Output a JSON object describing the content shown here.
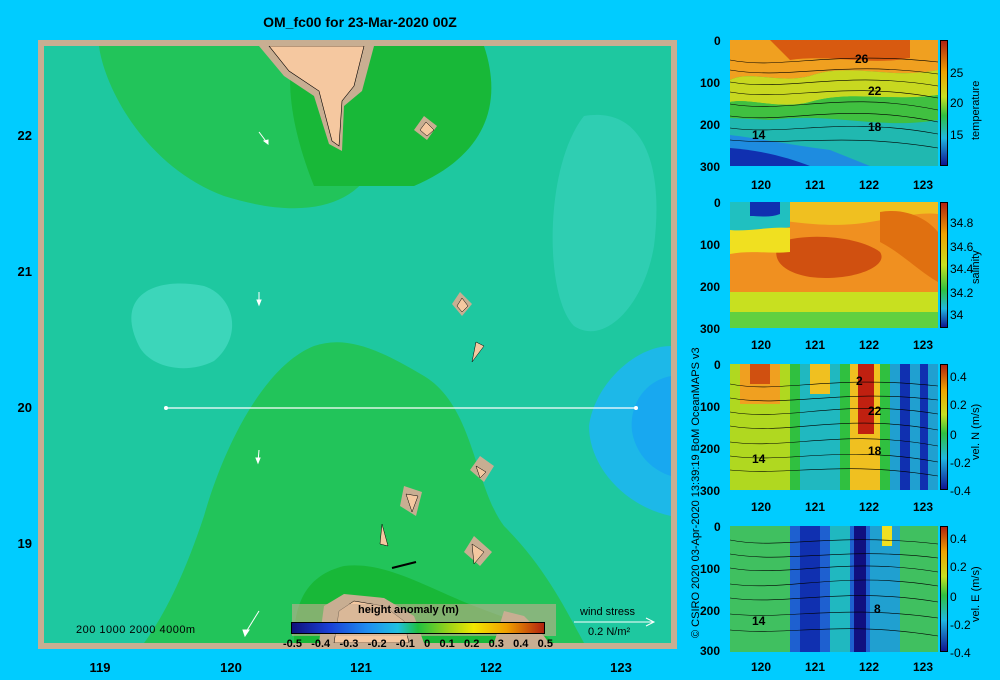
{
  "title": "OM_fc00 for 23-Mar-2020 00Z",
  "main_map": {
    "y_ticks": [
      "22",
      "21",
      "20",
      "19"
    ],
    "x_ticks": [
      "119",
      "120",
      "121",
      "122",
      "123"
    ],
    "depth_scale_label": "200  1000  2000  4000m",
    "colorbar": {
      "title": "height anomaly (m)",
      "tick_labels": [
        "-0.5",
        "-0.4",
        "-0.3",
        "-0.2",
        "-0.1",
        "0",
        "0.1",
        "0.2",
        "0.3",
        "0.4",
        "0.5"
      ],
      "colors": [
        "#10107a",
        "#1a3fd6",
        "#1f8df0",
        "#20c0e0",
        "#20d0a8",
        "#20c040",
        "#9ad21a",
        "#f0e800",
        "#f0b000",
        "#e06000",
        "#b02010"
      ]
    },
    "wind_stress": {
      "label": "wind stress",
      "value": "0.2 N/m²"
    },
    "colors": {
      "background": "#00ccff",
      "land": "#f5c8a0",
      "shelf": "#c8ae92",
      "sea_green": "#22c45a",
      "sea_teal": "#1ec8a0"
    }
  },
  "credit": "© CSIRO 2020   03-Apr-2020 13:39:19 BoM OceanMAPS v3",
  "sections": [
    {
      "variable": "temperature",
      "y_ticks": [
        "0",
        "100",
        "200",
        "300"
      ],
      "x_ticks": [
        "120",
        "121",
        "122",
        "123"
      ],
      "colorbar_ticks": [
        "25",
        "20",
        "15"
      ],
      "contour_labels": [
        "26",
        "22",
        "18",
        "14"
      ]
    },
    {
      "variable": "salinity",
      "y_ticks": [
        "0",
        "100",
        "200",
        "300"
      ],
      "x_ticks": [
        "120",
        "121",
        "122",
        "123"
      ],
      "colorbar_ticks": [
        "34.8",
        "34.6",
        "34.4",
        "34.2",
        "34"
      ],
      "contour_labels": []
    },
    {
      "variable": "vel. N  (m/s)",
      "y_ticks": [
        "0",
        "100",
        "200",
        "300"
      ],
      "x_ticks": [
        "120",
        "121",
        "122",
        "123"
      ],
      "colorbar_ticks": [
        "0.4",
        "0.2",
        "0",
        "-0.2",
        "-0.4"
      ],
      "contour_labels": [
        "2",
        "22",
        "18",
        "14"
      ]
    },
    {
      "variable": "vel. E  (m/s)",
      "y_ticks": [
        "0",
        "100",
        "200",
        "300"
      ],
      "x_ticks": [
        "120",
        "121",
        "122",
        "123"
      ],
      "colorbar_ticks": [
        "0.4",
        "0.2",
        "0",
        "-0.2",
        "-0.4"
      ],
      "contour_labels": [
        "8",
        "14"
      ]
    }
  ]
}
